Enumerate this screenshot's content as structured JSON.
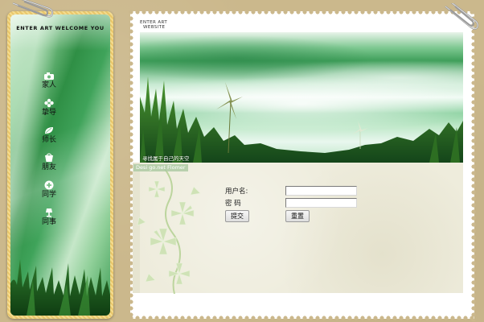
{
  "left_panel": {
    "title": "ENTER ART  WELCOME YOU",
    "nav": [
      {
        "label": "家人",
        "icon": "camera-icon"
      },
      {
        "label": "挚导",
        "icon": "flower-icon"
      },
      {
        "label": "师长",
        "icon": "leaf-icon"
      },
      {
        "label": "朋友",
        "icon": "bucket-icon"
      },
      {
        "label": "同学",
        "icon": "plus-icon"
      },
      {
        "label": "同事",
        "icon": "lamp-icon"
      }
    ]
  },
  "card": {
    "tag_line1": "ENTER ART",
    "tag_line2": "WEBSITE",
    "banner_caption": "寻找属于自己的天空",
    "flower_tag": "Desi go.net Flomer",
    "form": {
      "username_label": "用户名:",
      "password_label": "密  码",
      "username_value": "",
      "password_value": "",
      "submit_label": "提交",
      "reset_label": "重置"
    }
  },
  "colors": {
    "page_bg": "#cbb88c",
    "panel_border": "#e8c66a",
    "accent_green": "#3f9f5a",
    "content_bg": "#eeecdc"
  }
}
